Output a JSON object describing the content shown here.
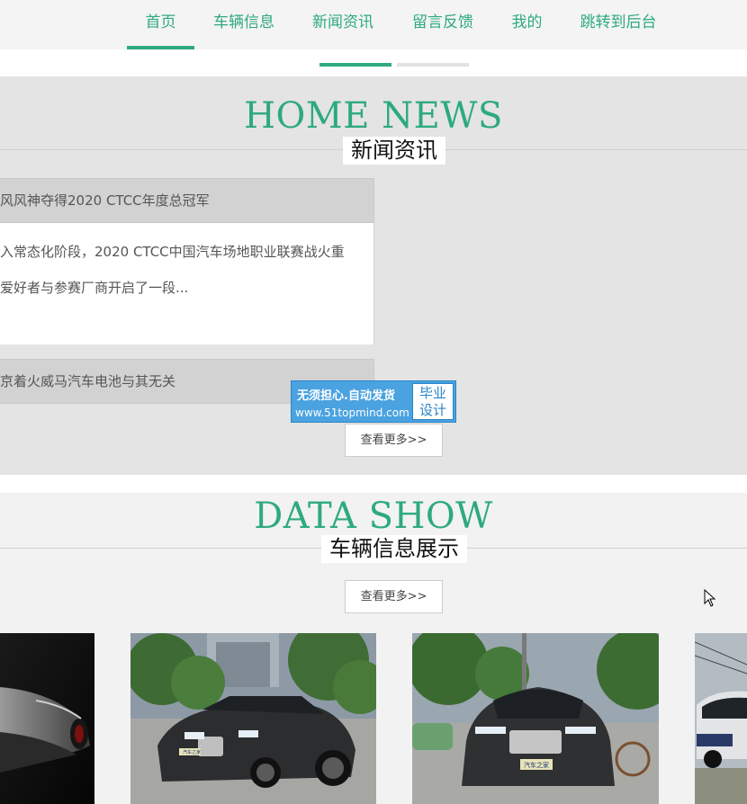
{
  "nav": {
    "items": [
      {
        "label": "首页",
        "active": true
      },
      {
        "label": "车辆信息",
        "active": false
      },
      {
        "label": "新闻资讯",
        "active": false
      },
      {
        "label": "留言反馈",
        "active": false
      },
      {
        "label": "我的",
        "active": false
      },
      {
        "label": "跳转到后台",
        "active": false
      }
    ]
  },
  "news": {
    "title_en": "HOME NEWS",
    "title_cn": "新闻资讯",
    "items": [
      {
        "title": "风风神夺得2020 CTCC年度总冠军",
        "summary_line1": "入常态化阶段，2020 CTCC中国汽车场地职业联赛战火重",
        "summary_line2": "爱好者与参赛厂商开启了一段..."
      },
      {
        "title": "京着火威马汽车电池与其无关"
      }
    ],
    "more_label": "查看更多>>"
  },
  "watermark": {
    "line1": "无须担心.自动发货",
    "line2": "www.51topmind.com",
    "right_top": "毕业",
    "right_bottom": "设计"
  },
  "data_show": {
    "title_en": "DATA SHOW",
    "title_cn": "车辆信息展示",
    "more_label": "查看更多>>",
    "cards": [
      {
        "image": "dark-concept-sports-car-photo"
      },
      {
        "image": "gray-bmw-7-series-sedan-photo",
        "plate": "汽车之家"
      },
      {
        "image": "gray-bmw-7-series-front-photo",
        "plate": "汽车之家"
      },
      {
        "image": "bmw-i3-parked-photo"
      }
    ]
  },
  "colors": {
    "accent": "#2eaa7d",
    "section_bg": "#e4e4e4"
  }
}
